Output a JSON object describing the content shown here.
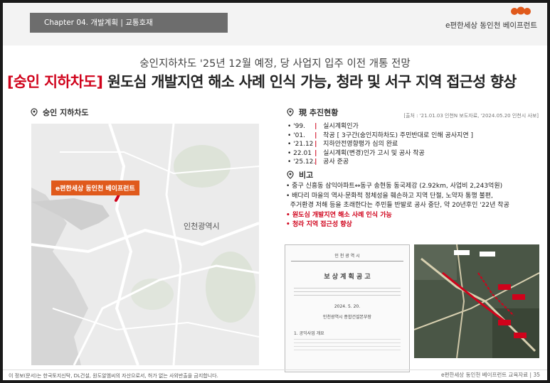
{
  "header": {
    "chapter_label": "Chapter 04. 개발계획 | 교통호재",
    "brand": "e편한세상 동인천 베이프런트"
  },
  "subtitle": "숭인지하차도 '25년 12월 예정, 당 사업지 입주 이전 개통 전망",
  "headline": {
    "bracket": "[숭인 지하차도]",
    "rest": " 원도심 개발지연 해소 사례 인식 가능, 청라 및 서구 지역 접근성 향상"
  },
  "left_section": {
    "title": "숭인 지하차도",
    "map_badge": "e편한세상 동인천 베이프런트",
    "map_city": "인천광역시"
  },
  "progress": {
    "title": "現 추진현황",
    "source": "[출처 : '21.01.03 인천N 보도자료, '2024.05.20 인천시 사보]",
    "items": [
      {
        "year": "'99.",
        "text": "실시계획인가"
      },
      {
        "year": "'01.",
        "text": "착공 [ 3구간(숭인지하차도) 주민반대로 인해 공사지연 ]"
      },
      {
        "year": "'21.12",
        "text": "지하안전영향평가 심의 완료"
      },
      {
        "year": "22.01",
        "text": "실시계획(변경)인가 고시 및 공사 착공"
      },
      {
        "year": "'25.12.",
        "text": "공사 준공"
      }
    ]
  },
  "notes": {
    "title": "비고",
    "items": [
      "중구 신흥동 삼익아파트↔동구 송현동 동국제강 (2.92km, 사업비 2,243억원)",
      "배다리 마을의 역사·문화적 정체성을 훼손하고 지역 단절, 노약자 통행 불편,",
      "주거환경 저해 등을 초래한다는 주민들 반발로 공사 중단, 약 20년후인 '22년 착공"
    ],
    "highlights": [
      "원도심 개발지연 해소 사례 인식 가능",
      "청라 지역 접근성 향상"
    ]
  },
  "document": {
    "org": "인 천 광 역 시",
    "title": "보 상 계 획 공 고",
    "date": "2024. 5. 20.",
    "issuer": "인천광역시 종합건설본부장",
    "section": "1. 공익사업 개요"
  },
  "footer": {
    "left": "이 정보(문서)는 한국토지신탁, DL건설, 원도알엠씨의 자산으로서, 허가 없는 사외반출을 금지합니다.",
    "right": "e편한세상 동인천 베이프런트 교육자료 | 35"
  },
  "colors": {
    "accent_red": "#d0021b",
    "brand_orange": "#e05a1c",
    "tab_gray": "#6d6d6d"
  }
}
